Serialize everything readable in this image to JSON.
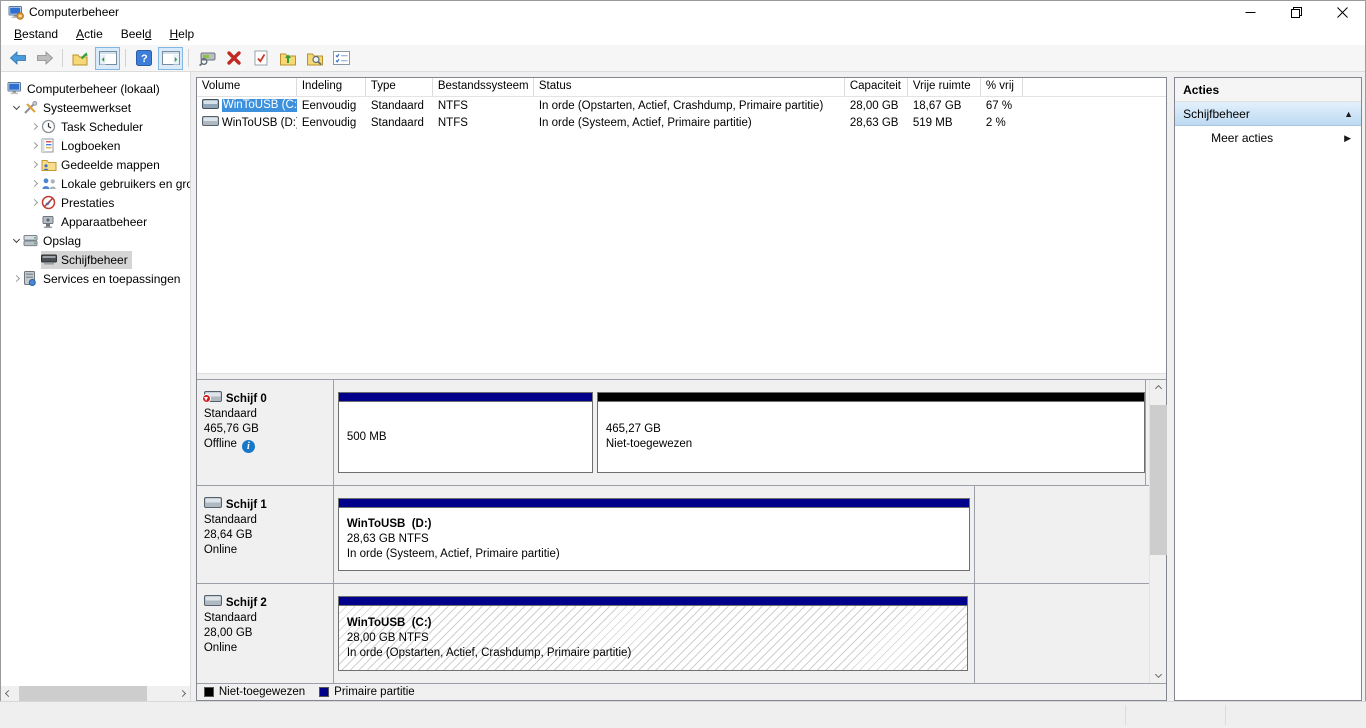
{
  "window": {
    "title": "Computerbeheer",
    "control_icons": [
      "minimize",
      "restore-down",
      "close"
    ]
  },
  "menu": {
    "items": [
      {
        "pre": "",
        "key": "B",
        "post": "estand"
      },
      {
        "pre": "",
        "key": "A",
        "post": "ctie"
      },
      {
        "pre": "Beel",
        "key": "d",
        "post": ""
      },
      {
        "pre": "",
        "key": "H",
        "post": "elp"
      }
    ]
  },
  "toolbar": {
    "icons": [
      "back",
      "forward",
      "up-level",
      "show-hide-console-tree",
      "help",
      "show-hide-action-pane",
      "rescan-disks",
      "delete-volume",
      "mark-partition-active",
      "open",
      "explore",
      "properties"
    ]
  },
  "tree": {
    "items": [
      {
        "label": "Computerbeheer (lokaal)",
        "icon": "computer",
        "expander": "none",
        "selected": false
      },
      {
        "label": "Systeemwerkset",
        "icon": "toolset",
        "expander": "expanded",
        "selected": false
      },
      {
        "label": "Task Scheduler",
        "icon": "task-scheduler",
        "expander": "collapsed",
        "selected": false
      },
      {
        "label": "Logboeken",
        "icon": "event-log",
        "expander": "collapsed",
        "selected": false
      },
      {
        "label": "Gedeelde mappen",
        "icon": "shared-folders",
        "expander": "collapsed",
        "selected": false
      },
      {
        "label": "Lokale gebruikers en groepen",
        "icon": "local-users",
        "expander": "collapsed",
        "selected": false
      },
      {
        "label": "Prestaties",
        "icon": "performance",
        "expander": "collapsed",
        "selected": false
      },
      {
        "label": "Apparaatbeheer",
        "icon": "device-manager",
        "expander": "none",
        "selected": false
      },
      {
        "label": "Opslag",
        "icon": "storage",
        "expander": "expanded",
        "selected": false
      },
      {
        "label": "Schijfbeheer",
        "icon": "disk-management",
        "expander": "none",
        "selected": true
      },
      {
        "label": "Services en toepassingen",
        "icon": "services",
        "expander": "collapsed",
        "selected": false
      }
    ]
  },
  "volume_list": {
    "columns": [
      {
        "label": "Volume"
      },
      {
        "label": "Indeling"
      },
      {
        "label": "Type"
      },
      {
        "label": "Bestandssysteem"
      },
      {
        "label": "Status"
      },
      {
        "label": "Capaciteit"
      },
      {
        "label": "Vrije ruimte"
      },
      {
        "label": "% vrij"
      }
    ],
    "rows": [
      {
        "volume": "WinToUSB (C:)",
        "indeling": "Eenvoudig",
        "type": "Standaard",
        "fs": "NTFS",
        "status": "In orde (Opstarten, Actief, Crashdump, Primaire partitie)",
        "capacity": "28,00 GB",
        "free": "18,67 GB",
        "pct_free": "67 %",
        "selected": true
      },
      {
        "volume": "WinToUSB (D:)",
        "indeling": "Eenvoudig",
        "type": "Standaard",
        "fs": "NTFS",
        "status": "In orde (Systeem, Actief, Primaire partitie)",
        "capacity": "28,63 GB",
        "free": "519 MB",
        "pct_free": "2 %",
        "selected": false
      }
    ]
  },
  "disks": [
    {
      "name": "Schijf 0",
      "type": "Standaard",
      "size": "465,76 GB",
      "status": "Offline",
      "has_info_icon": true,
      "partitions": [
        {
          "line1": "500 MB",
          "line2": "",
          "line3": "",
          "band": "primary"
        },
        {
          "line1": "465,27 GB",
          "line2": "Niet-toegewezen",
          "line3": "",
          "band": "unallocated"
        }
      ]
    },
    {
      "name": "Schijf 1",
      "type": "Standaard",
      "size": "28,64 GB",
      "status": "Online",
      "has_info_icon": false,
      "partitions": [
        {
          "line1": "WinToUSB  (D:)",
          "line2": "28,63 GB NTFS",
          "line3": "In orde (Systeem, Actief, Primaire partitie)",
          "band": "primary"
        }
      ]
    },
    {
      "name": "Schijf 2",
      "type": "Standaard",
      "size": "28,00 GB",
      "status": "Online",
      "has_info_icon": false,
      "partitions": [
        {
          "line1": "WinToUSB  (C:)",
          "line2": "28,00 GB NTFS",
          "line3": "In orde (Opstarten, Actief, Crashdump, Primaire partitie)",
          "band": "primary"
        }
      ]
    }
  ],
  "legend": {
    "items": [
      {
        "label": "Niet-toegewezen",
        "color": "#000000"
      },
      {
        "label": "Primaire partitie",
        "color": "#00008b"
      }
    ]
  },
  "actions": {
    "title": "Acties",
    "group": "Schijfbeheer",
    "more": "Meer acties"
  },
  "colors": {
    "selection_blue": "#3c90dc",
    "primary_partition": "#00008b",
    "unallocated_black": "#000000",
    "toolbar_toggle": "#d9eafa"
  }
}
